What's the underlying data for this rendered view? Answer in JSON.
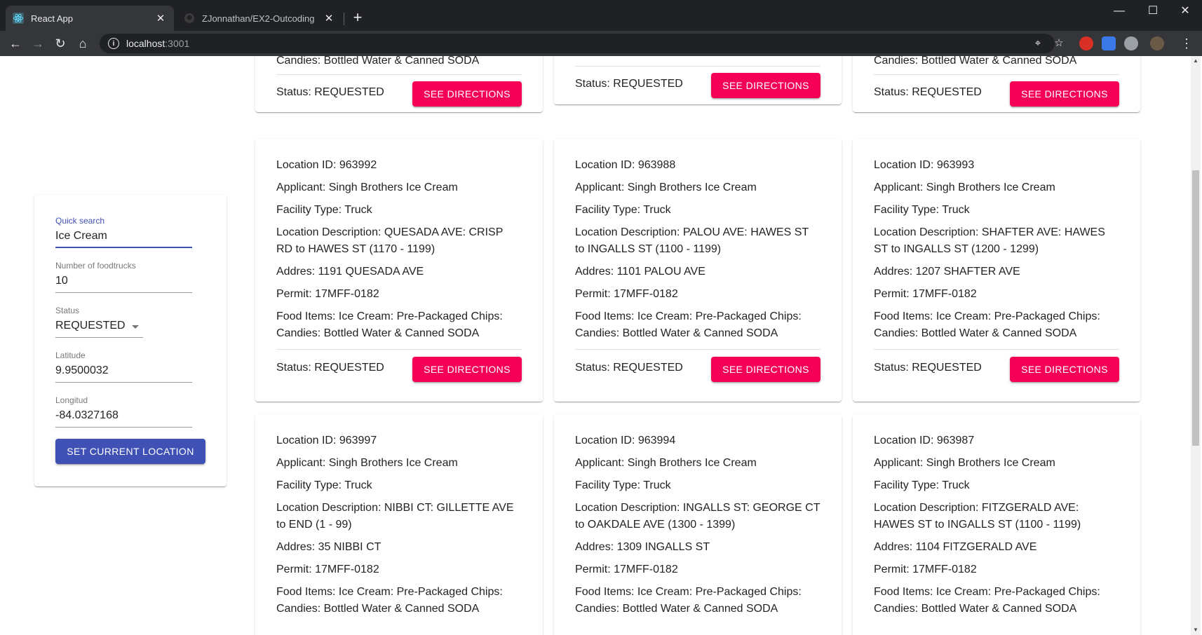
{
  "browser": {
    "tabs": [
      {
        "title": "React App",
        "active": true
      },
      {
        "title": "ZJonnathan/EX2-Outcoding",
        "active": false
      }
    ],
    "address": {
      "host": "localhost",
      "port": ":3001"
    }
  },
  "search_panel": {
    "quick_search": {
      "label": "Quick search",
      "value": "Ice Cream"
    },
    "num_foodtrucks": {
      "label": "Number of foodtrucks",
      "value": "10"
    },
    "status": {
      "label": "Status",
      "value": "REQUESTED"
    },
    "latitude": {
      "label": "Latitude",
      "value": "9.9500032"
    },
    "longitude": {
      "label": "Longitud",
      "value": "-84.0327168"
    },
    "set_location_button": "SET CURRENT LOCATION"
  },
  "button_label": "SEE DIRECTIONS",
  "top_row": [
    {
      "food": "Candies: Bottled Water & Canned SODA",
      "status": "Status: REQUESTED"
    },
    {
      "status": "Status: REQUESTED"
    },
    {
      "food": "Candies: Bottled Water & Canned SODA",
      "status": "Status: REQUESTED"
    }
  ],
  "cards": [
    {
      "location_id": "Location ID: 963992",
      "applicant": "Applicant: Singh Brothers Ice Cream",
      "facility": "Facility Type: Truck",
      "description": "Location Description: QUESADA AVE: CRISP RD to HAWES ST (1170 - 1199)",
      "address": "Addres: 1191 QUESADA AVE",
      "permit": "Permit: 17MFF-0182",
      "food": "Food Items: Ice Cream: Pre-Packaged Chips: Candies: Bottled Water & Canned SODA",
      "status": "Status: REQUESTED"
    },
    {
      "location_id": "Location ID: 963988",
      "applicant": "Applicant: Singh Brothers Ice Cream",
      "facility": "Facility Type: Truck",
      "description": "Location Description: PALOU AVE: HAWES ST to INGALLS ST (1100 - 1199)",
      "address": "Addres: 1101 PALOU AVE",
      "permit": "Permit: 17MFF-0182",
      "food": "Food Items: Ice Cream: Pre-Packaged Chips: Candies: Bottled Water & Canned SODA",
      "status": "Status: REQUESTED"
    },
    {
      "location_id": "Location ID: 963993",
      "applicant": "Applicant: Singh Brothers Ice Cream",
      "facility": "Facility Type: Truck",
      "description": "Location Description: SHAFTER AVE: HAWES ST to INGALLS ST (1200 - 1299)",
      "address": "Addres: 1207 SHAFTER AVE",
      "permit": "Permit: 17MFF-0182",
      "food": "Food Items: Ice Cream: Pre-Packaged Chips: Candies: Bottled Water & Canned SODA",
      "status": "Status: REQUESTED"
    },
    {
      "location_id": "Location ID: 963997",
      "applicant": "Applicant: Singh Brothers Ice Cream",
      "facility": "Facility Type: Truck",
      "description": "Location Description: NIBBI CT: GILLETTE AVE to END (1 - 99)",
      "address": "Addres: 35 NIBBI CT",
      "permit": "Permit: 17MFF-0182",
      "food": "Food Items: Ice Cream: Pre-Packaged Chips: Candies: Bottled Water & Canned SODA"
    },
    {
      "location_id": "Location ID: 963994",
      "applicant": "Applicant: Singh Brothers Ice Cream",
      "facility": "Facility Type: Truck",
      "description": "Location Description: INGALLS ST: GEORGE CT to OAKDALE AVE (1300 - 1399)",
      "address": "Addres: 1309 INGALLS ST",
      "permit": "Permit: 17MFF-0182",
      "food": "Food Items: Ice Cream: Pre-Packaged Chips: Candies: Bottled Water & Canned SODA"
    },
    {
      "location_id": "Location ID: 963987",
      "applicant": "Applicant: Singh Brothers Ice Cream",
      "facility": "Facility Type: Truck",
      "description": "Location Description: FITZGERALD AVE: HAWES ST to INGALLS ST (1100 - 1199)",
      "address": "Addres: 1104 FITZGERALD AVE",
      "permit": "Permit: 17MFF-0182",
      "food": "Food Items: Ice Cream: Pre-Packaged Chips: Candies: Bottled Water & Canned SODA"
    }
  ],
  "colors": {
    "primary": "#3f51b5",
    "secondary": "#f50057",
    "chrome_dark": "#202124"
  }
}
